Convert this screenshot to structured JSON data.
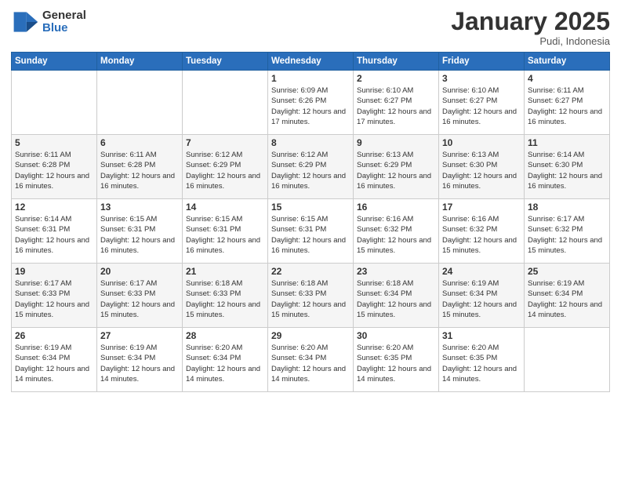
{
  "header": {
    "logo_general": "General",
    "logo_blue": "Blue",
    "month_title": "January 2025",
    "subtitle": "Pudi, Indonesia"
  },
  "weekdays": [
    "Sunday",
    "Monday",
    "Tuesday",
    "Wednesday",
    "Thursday",
    "Friday",
    "Saturday"
  ],
  "weeks": [
    [
      {
        "day": "",
        "info": ""
      },
      {
        "day": "",
        "info": ""
      },
      {
        "day": "",
        "info": ""
      },
      {
        "day": "1",
        "info": "Sunrise: 6:09 AM\nSunset: 6:26 PM\nDaylight: 12 hours and 17 minutes."
      },
      {
        "day": "2",
        "info": "Sunrise: 6:10 AM\nSunset: 6:27 PM\nDaylight: 12 hours and 17 minutes."
      },
      {
        "day": "3",
        "info": "Sunrise: 6:10 AM\nSunset: 6:27 PM\nDaylight: 12 hours and 16 minutes."
      },
      {
        "day": "4",
        "info": "Sunrise: 6:11 AM\nSunset: 6:27 PM\nDaylight: 12 hours and 16 minutes."
      }
    ],
    [
      {
        "day": "5",
        "info": "Sunrise: 6:11 AM\nSunset: 6:28 PM\nDaylight: 12 hours and 16 minutes."
      },
      {
        "day": "6",
        "info": "Sunrise: 6:11 AM\nSunset: 6:28 PM\nDaylight: 12 hours and 16 minutes."
      },
      {
        "day": "7",
        "info": "Sunrise: 6:12 AM\nSunset: 6:29 PM\nDaylight: 12 hours and 16 minutes."
      },
      {
        "day": "8",
        "info": "Sunrise: 6:12 AM\nSunset: 6:29 PM\nDaylight: 12 hours and 16 minutes."
      },
      {
        "day": "9",
        "info": "Sunrise: 6:13 AM\nSunset: 6:29 PM\nDaylight: 12 hours and 16 minutes."
      },
      {
        "day": "10",
        "info": "Sunrise: 6:13 AM\nSunset: 6:30 PM\nDaylight: 12 hours and 16 minutes."
      },
      {
        "day": "11",
        "info": "Sunrise: 6:14 AM\nSunset: 6:30 PM\nDaylight: 12 hours and 16 minutes."
      }
    ],
    [
      {
        "day": "12",
        "info": "Sunrise: 6:14 AM\nSunset: 6:31 PM\nDaylight: 12 hours and 16 minutes."
      },
      {
        "day": "13",
        "info": "Sunrise: 6:15 AM\nSunset: 6:31 PM\nDaylight: 12 hours and 16 minutes."
      },
      {
        "day": "14",
        "info": "Sunrise: 6:15 AM\nSunset: 6:31 PM\nDaylight: 12 hours and 16 minutes."
      },
      {
        "day": "15",
        "info": "Sunrise: 6:15 AM\nSunset: 6:31 PM\nDaylight: 12 hours and 16 minutes."
      },
      {
        "day": "16",
        "info": "Sunrise: 6:16 AM\nSunset: 6:32 PM\nDaylight: 12 hours and 15 minutes."
      },
      {
        "day": "17",
        "info": "Sunrise: 6:16 AM\nSunset: 6:32 PM\nDaylight: 12 hours and 15 minutes."
      },
      {
        "day": "18",
        "info": "Sunrise: 6:17 AM\nSunset: 6:32 PM\nDaylight: 12 hours and 15 minutes."
      }
    ],
    [
      {
        "day": "19",
        "info": "Sunrise: 6:17 AM\nSunset: 6:33 PM\nDaylight: 12 hours and 15 minutes."
      },
      {
        "day": "20",
        "info": "Sunrise: 6:17 AM\nSunset: 6:33 PM\nDaylight: 12 hours and 15 minutes."
      },
      {
        "day": "21",
        "info": "Sunrise: 6:18 AM\nSunset: 6:33 PM\nDaylight: 12 hours and 15 minutes."
      },
      {
        "day": "22",
        "info": "Sunrise: 6:18 AM\nSunset: 6:33 PM\nDaylight: 12 hours and 15 minutes."
      },
      {
        "day": "23",
        "info": "Sunrise: 6:18 AM\nSunset: 6:34 PM\nDaylight: 12 hours and 15 minutes."
      },
      {
        "day": "24",
        "info": "Sunrise: 6:19 AM\nSunset: 6:34 PM\nDaylight: 12 hours and 15 minutes."
      },
      {
        "day": "25",
        "info": "Sunrise: 6:19 AM\nSunset: 6:34 PM\nDaylight: 12 hours and 14 minutes."
      }
    ],
    [
      {
        "day": "26",
        "info": "Sunrise: 6:19 AM\nSunset: 6:34 PM\nDaylight: 12 hours and 14 minutes."
      },
      {
        "day": "27",
        "info": "Sunrise: 6:19 AM\nSunset: 6:34 PM\nDaylight: 12 hours and 14 minutes."
      },
      {
        "day": "28",
        "info": "Sunrise: 6:20 AM\nSunset: 6:34 PM\nDaylight: 12 hours and 14 minutes."
      },
      {
        "day": "29",
        "info": "Sunrise: 6:20 AM\nSunset: 6:34 PM\nDaylight: 12 hours and 14 minutes."
      },
      {
        "day": "30",
        "info": "Sunrise: 6:20 AM\nSunset: 6:35 PM\nDaylight: 12 hours and 14 minutes."
      },
      {
        "day": "31",
        "info": "Sunrise: 6:20 AM\nSunset: 6:35 PM\nDaylight: 12 hours and 14 minutes."
      },
      {
        "day": "",
        "info": ""
      }
    ]
  ]
}
